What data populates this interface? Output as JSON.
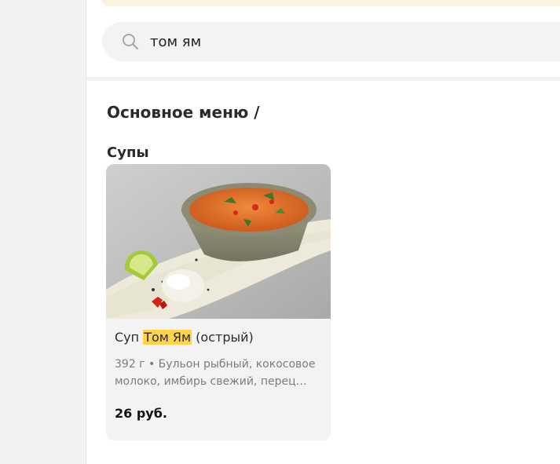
{
  "search": {
    "value": "том ям"
  },
  "menu": {
    "breadcrumb": "Основное меню /",
    "category": "Супы"
  },
  "product": {
    "title_prefix": "Суп ",
    "title_match": "Том Ям",
    "title_suffix": " (острый)",
    "description": "392 г • Бульон рыбный, кокосовое молоко, имбирь свежий, перец…",
    "price": "26 руб."
  },
  "colors": {
    "highlight": "#ffd44a",
    "notice": "#fbf3de",
    "surface": "#f3f3f3"
  }
}
